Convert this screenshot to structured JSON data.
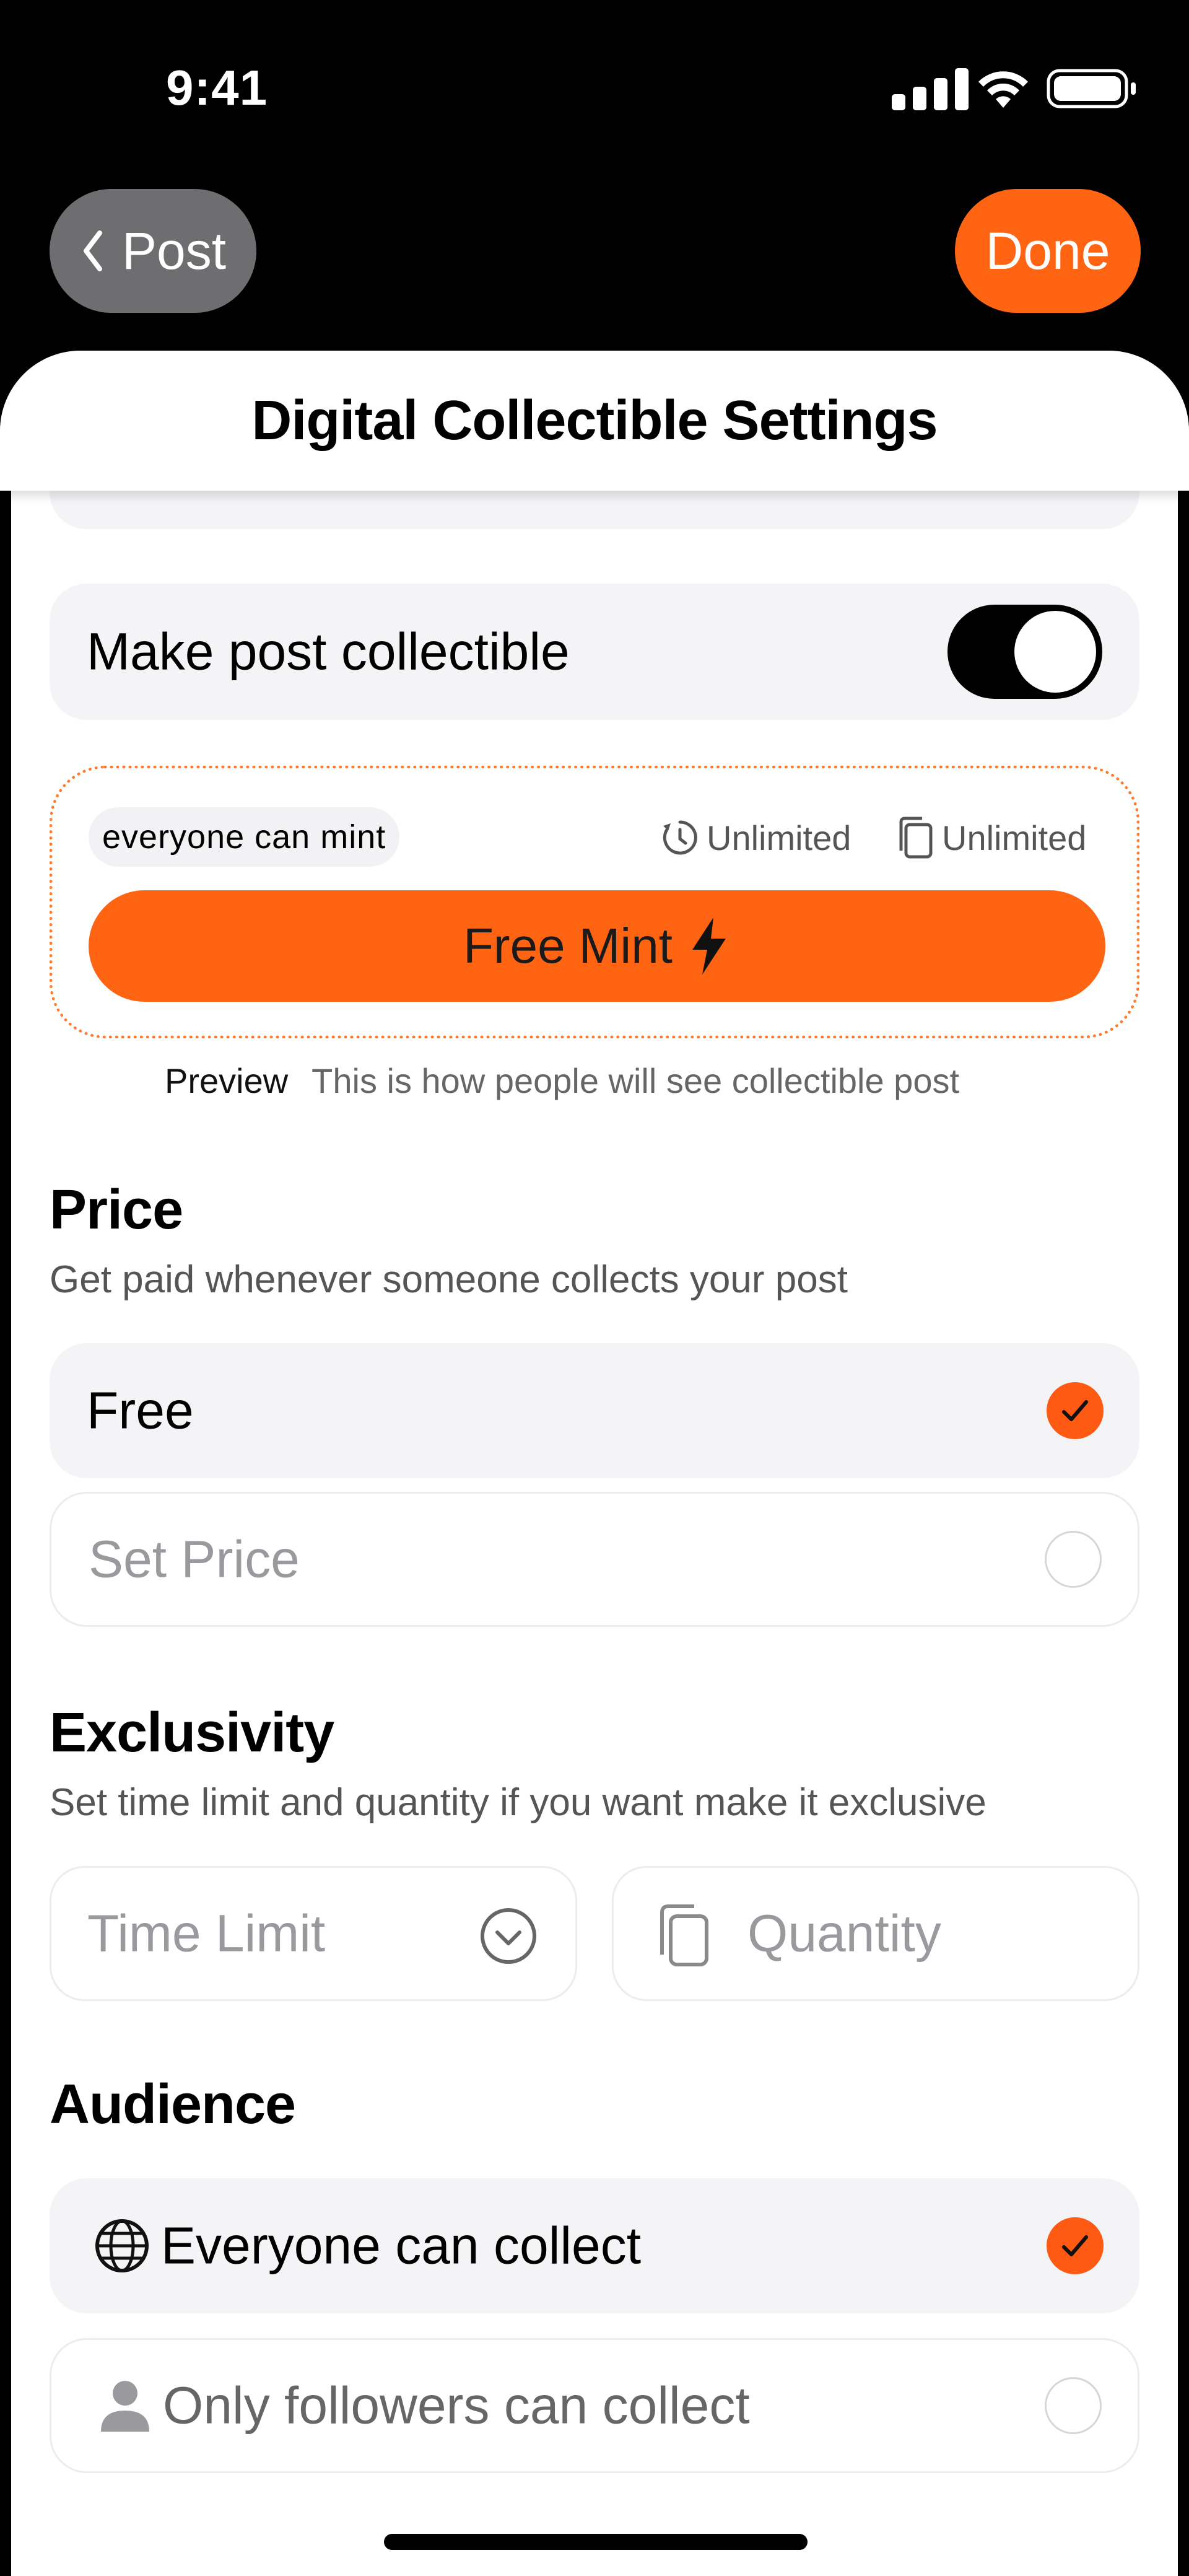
{
  "status_bar": {
    "time": "9:41"
  },
  "nav": {
    "back_label": "Post",
    "done_label": "Done"
  },
  "sheet": {
    "title": "Digital Collectible Settings"
  },
  "collectible_toggle": {
    "label": "Make post collectible",
    "enabled": true
  },
  "preview": {
    "audience_pill": "everyone can mint",
    "time_limit": "Unlimited",
    "quantity": "Unlimited",
    "mint_button": "Free Mint",
    "caption_label": "Preview",
    "caption_text": "This is how people will see collectible post"
  },
  "price": {
    "title": "Price",
    "subtitle": "Get paid whenever someone collects your post",
    "options": [
      {
        "label": "Free",
        "selected": true
      },
      {
        "label": "Set Price",
        "selected": false
      }
    ]
  },
  "exclusivity": {
    "title": "Exclusivity",
    "subtitle": "Set time limit and quantity if you want make it exclusive",
    "time_limit_placeholder": "Time Limit",
    "quantity_placeholder": "Quantity"
  },
  "audience": {
    "title": "Audience",
    "options": [
      {
        "label": "Everyone can collect",
        "icon": "globe-icon",
        "selected": true
      },
      {
        "label": "Only followers can collect",
        "icon": "person-icon",
        "selected": false
      }
    ]
  },
  "colors": {
    "accent": "#ff6413",
    "card_bg": "#f4f4f6",
    "back_button": "#6e6e70"
  }
}
